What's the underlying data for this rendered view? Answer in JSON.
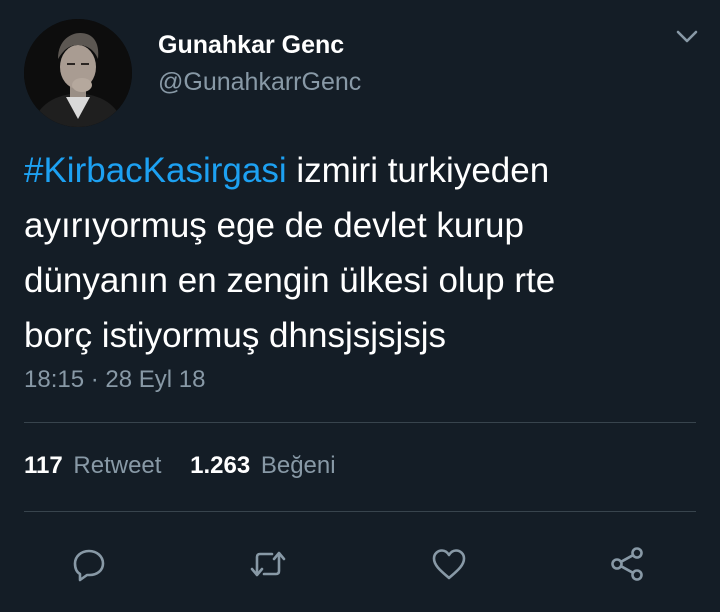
{
  "author": {
    "display_name": "Gunahkar Genc",
    "handle": "@GunahkarrGenc"
  },
  "tweet": {
    "hashtag": "#KirbacKasirgasi",
    "lines": [
      " izmiri turkiyeden",
      "ayırıyormuş ege de devlet kurup",
      "dünyanın en zengin ülkesi olup rte",
      "borç istiyormuş dhnsjsjsjsjs"
    ],
    "timestamp": "18:15 · 28 Eyl 18"
  },
  "stats": {
    "retweets_count": "117",
    "retweets_label": "Retweet",
    "likes_count": "1.263",
    "likes_label": "Beğeni"
  },
  "actions": [
    {
      "name": "reply",
      "icon": "reply-bubble-icon"
    },
    {
      "name": "retweet",
      "icon": "retweet-icon"
    },
    {
      "name": "like",
      "icon": "heart-icon"
    },
    {
      "name": "share",
      "icon": "share-icon"
    }
  ],
  "colors": {
    "background": "#141d26",
    "text": "#ffffff",
    "muted": "#8899a6",
    "link": "#1da1f2",
    "divider": "#38444d"
  }
}
